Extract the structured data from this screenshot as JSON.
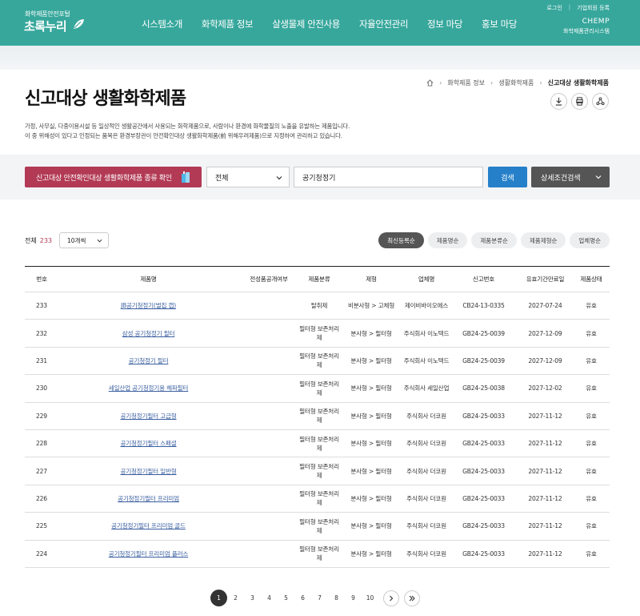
{
  "header": {
    "logo_sub": "화학제품안전포털",
    "logo_main": "초록누리",
    "nav": [
      "시스템소개",
      "화학제품 정보",
      "살생물제 안전사용",
      "자율안전관리",
      "정보 마당",
      "홍보 마당"
    ],
    "util_login": "로그인",
    "util_join": "기업회원 등록",
    "chemp_title": "CHEMP",
    "chemp_sub": "화학제품관리시스템",
    "brand_color": "#37a79c"
  },
  "breadcrumb": {
    "items": [
      "화학제품 정보",
      "생활화학제품"
    ],
    "current": "신고대상 생활화학제품"
  },
  "page": {
    "title": "신고대상 생활화학제품",
    "desc_line1": "가정, 사무실, 다중이용시설 등 일상적인 생활공간에서 사용되는 화학제품으로, 사람이나 환경에 화학물질의 노출을 유발하는 제품입니다.",
    "desc_line2": "이 중 위해성이 있다고 인정되는 품목은 환경부장관이 안전확인대상 생활화학제품(前 위해우려제품)으로 지정하여 관리하고 있습니다."
  },
  "search": {
    "check_button": "신고대상 안전확인대상 생활화학제품 종류 확인",
    "scope_selected": "전체",
    "query": "공기청정기",
    "search_button": "검색",
    "detail_button": "상세조건검색",
    "check_color": "#b23a55",
    "search_color": "#2680c9"
  },
  "list": {
    "total_label": "전체",
    "total_count": "233",
    "per_page": "10개씩",
    "sorts": [
      "최신등록순",
      "제품명순",
      "제품분류순",
      "제품제형순",
      "업체명순"
    ]
  },
  "table": {
    "headers": [
      "번호",
      "제품명",
      "전성품공개여부",
      "제품분류",
      "제형",
      "업체명",
      "신고번호",
      "유효기간만료일",
      "제품상태"
    ],
    "rows": [
      {
        "no": "233",
        "name": "JB공기청정기(벌집 캡)",
        "pub": "",
        "cls": "탈취제",
        "type": "비분사형 > 고체형",
        "comp": "제이비바이오에스",
        "rep": "CB24-13-0335",
        "exp": "2027-07-24",
        "stat": "유효"
      },
      {
        "no": "232",
        "name": "삼성 공기청정기 필터",
        "pub": "",
        "cls": "필터형 보존처리제",
        "type": "분사형 > 필터형",
        "comp": "주식회사 이노텍드",
        "rep": "GB24-25-0039",
        "exp": "2027-12-09",
        "stat": "유효"
      },
      {
        "no": "231",
        "name": "공기청정기 필터",
        "pub": "",
        "cls": "필터형 보존처리제",
        "type": "분사형 > 필터형",
        "comp": "주식회사 이노텍드",
        "rep": "GB24-25-0039",
        "exp": "2027-12-09",
        "stat": "유효"
      },
      {
        "no": "230",
        "name": "세일산업 공기청정기용 헤파필터",
        "pub": "",
        "cls": "필터형 보존처리제",
        "type": "분사형 > 필터형",
        "comp": "주식회사 세일산업",
        "rep": "GB24-25-0038",
        "exp": "2027-12-02",
        "stat": "유효"
      },
      {
        "no": "229",
        "name": "공기청정기필터 고급형",
        "pub": "",
        "cls": "필터형 보존처리제",
        "type": "분사형 > 필터형",
        "comp": "주식회사 더코원",
        "rep": "GB24-25-0033",
        "exp": "2027-11-12",
        "stat": "유효"
      },
      {
        "no": "228",
        "name": "공기청정기필터 스페셜",
        "pub": "",
        "cls": "필터형 보존처리제",
        "type": "분사형 > 필터형",
        "comp": "주식회사 더코원",
        "rep": "GB24-25-0033",
        "exp": "2027-11-12",
        "stat": "유효"
      },
      {
        "no": "227",
        "name": "공기청정기필터 일반형",
        "pub": "",
        "cls": "필터형 보존처리제",
        "type": "분사형 > 필터형",
        "comp": "주식회사 더코원",
        "rep": "GB24-25-0033",
        "exp": "2027-11-12",
        "stat": "유효"
      },
      {
        "no": "226",
        "name": "공기청정기필터 프리미엄",
        "pub": "",
        "cls": "필터형 보존처리제",
        "type": "분사형 > 필터형",
        "comp": "주식회사 더코원",
        "rep": "GB24-25-0033",
        "exp": "2027-11-12",
        "stat": "유효"
      },
      {
        "no": "225",
        "name": "공기청정기필터 프리미엄 골드",
        "pub": "",
        "cls": "필터형 보존처리제",
        "type": "분사형 > 필터형",
        "comp": "주식회사 더코원",
        "rep": "GB24-25-0033",
        "exp": "2027-11-12",
        "stat": "유효"
      },
      {
        "no": "224",
        "name": "공기청정기필터 프리미엄 플러스",
        "pub": "",
        "cls": "필터형 보존처리제",
        "type": "분사형 > 필터형",
        "comp": "주식회사 더코원",
        "rep": "GB24-25-0033",
        "exp": "2027-11-12",
        "stat": "유효"
      }
    ]
  },
  "pagination": {
    "pages": [
      "1",
      "2",
      "3",
      "4",
      "5",
      "6",
      "7",
      "8",
      "9",
      "10"
    ],
    "current": "1"
  }
}
